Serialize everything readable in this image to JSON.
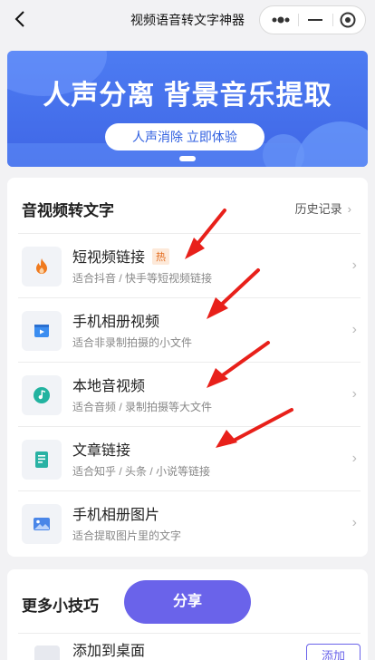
{
  "nav": {
    "title": "视频语音转文字神器",
    "back_icon": "chevron-left-icon",
    "more_icon": "more-dots-icon",
    "minimize_icon": "minimize-icon",
    "close_icon": "target-circle-icon"
  },
  "banner": {
    "title": "人声分离 背景音乐提取",
    "button_label": "人声消除 立即体验",
    "color": "#4272ea"
  },
  "section1": {
    "title": "音视频转文字",
    "link_label": "历史记录",
    "items": [
      {
        "title": "短视频链接",
        "badge": "热",
        "subtitle": "适合抖音 / 快手等短视频链接",
        "icon": "flame-icon",
        "icon_color": "#f07a1e"
      },
      {
        "title": "手机相册视频",
        "subtitle": "适合非录制拍摄的小文件",
        "icon": "video-icon",
        "icon_color": "#3b8df0"
      },
      {
        "title": "本地音视频",
        "subtitle": "适合音频 / 录制拍摄等大文件",
        "icon": "music-note-icon",
        "icon_color": "#22b3a0"
      },
      {
        "title": "文章链接",
        "subtitle": "适合知乎 / 头条 / 小说等链接",
        "icon": "document-icon",
        "icon_color": "#29b2a4"
      },
      {
        "title": "手机相册图片",
        "subtitle": "适合提取图片里的文字",
        "icon": "image-icon",
        "icon_color": "#4a86e8"
      }
    ]
  },
  "section2": {
    "title": "更多小技巧",
    "share_label": "分享",
    "add_title": "添加到桌面",
    "add_button": "添加",
    "accent": "#6a63ea"
  },
  "arrows": {
    "color": "#e8201a"
  }
}
